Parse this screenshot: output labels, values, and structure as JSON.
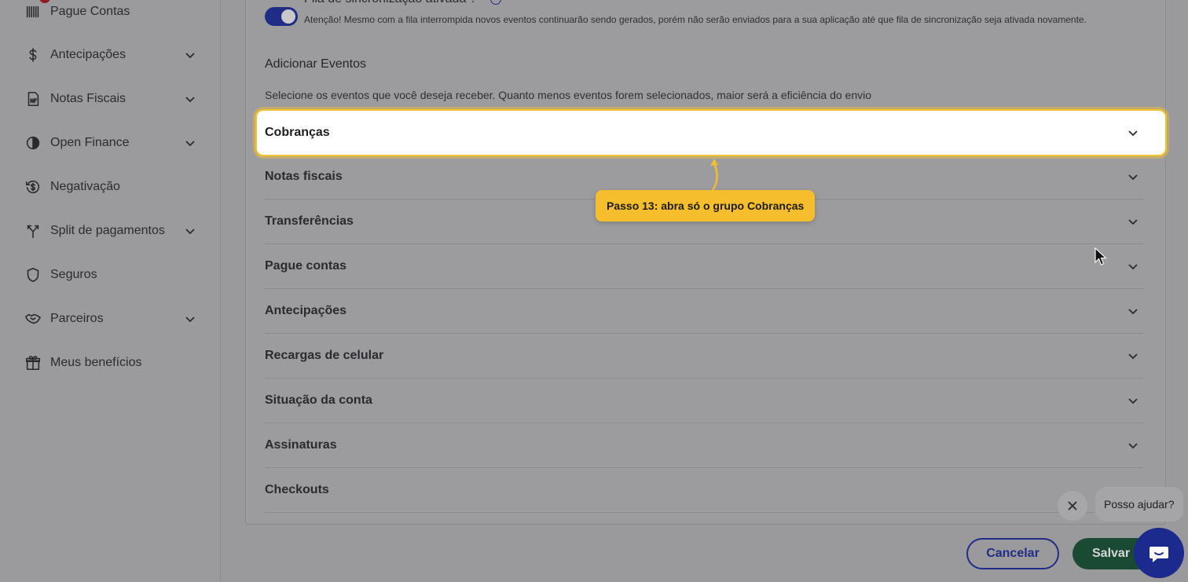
{
  "sidebar": {
    "items": [
      {
        "label": "Pague Contas",
        "icon": "barcode-icon",
        "has_chevron": false
      },
      {
        "label": "Antecipações",
        "icon": "dollar-icon",
        "has_chevron": true
      },
      {
        "label": "Notas Fiscais",
        "icon": "invoice-icon",
        "has_chevron": true
      },
      {
        "label": "Open Finance",
        "icon": "open-finance-icon",
        "has_chevron": true
      },
      {
        "label": "Negativação",
        "icon": "negative-money-icon",
        "has_chevron": false
      },
      {
        "label": "Split de pagamentos",
        "icon": "split-icon",
        "has_chevron": true
      },
      {
        "label": "Seguros",
        "icon": "shield-icon",
        "has_chevron": false
      },
      {
        "label": "Parceiros",
        "icon": "handshake-icon",
        "has_chevron": true
      },
      {
        "label": "Meus benefícios",
        "icon": "gift-icon",
        "has_chevron": false
      }
    ]
  },
  "sync": {
    "title": "Fila de sincronização ativada ?",
    "warning": "Atenção! Mesmo com a fila interrompida novos eventos continuarão sendo gerados, porém não serão enviados para a sua aplicação até que fila de sincronização seja ativada novamente.",
    "enabled": true
  },
  "events": {
    "title": "Adicionar Eventos",
    "description": "Selecione os eventos que você deseja receber. Quanto menos eventos forem selecionados, maior será a eficiência do envio",
    "groups": [
      {
        "label": "Cobranças",
        "highlighted": true
      },
      {
        "label": "Notas fiscais"
      },
      {
        "label": "Transferências"
      },
      {
        "label": "Pague contas"
      },
      {
        "label": "Antecipações"
      },
      {
        "label": "Recargas de celular"
      },
      {
        "label": "Situação da conta"
      },
      {
        "label": "Assinaturas"
      },
      {
        "label": "Checkouts"
      }
    ]
  },
  "tooltip": {
    "text": "Passo 13: abra só o grupo Cobranças"
  },
  "actions": {
    "cancel_label": "Cancelar",
    "save_label": "Salvar"
  },
  "chat": {
    "help_text": "Posso ajudar?"
  },
  "colors": {
    "primary": "#1f2d86",
    "save": "#1b4a34",
    "highlight": "#f6be2c"
  }
}
